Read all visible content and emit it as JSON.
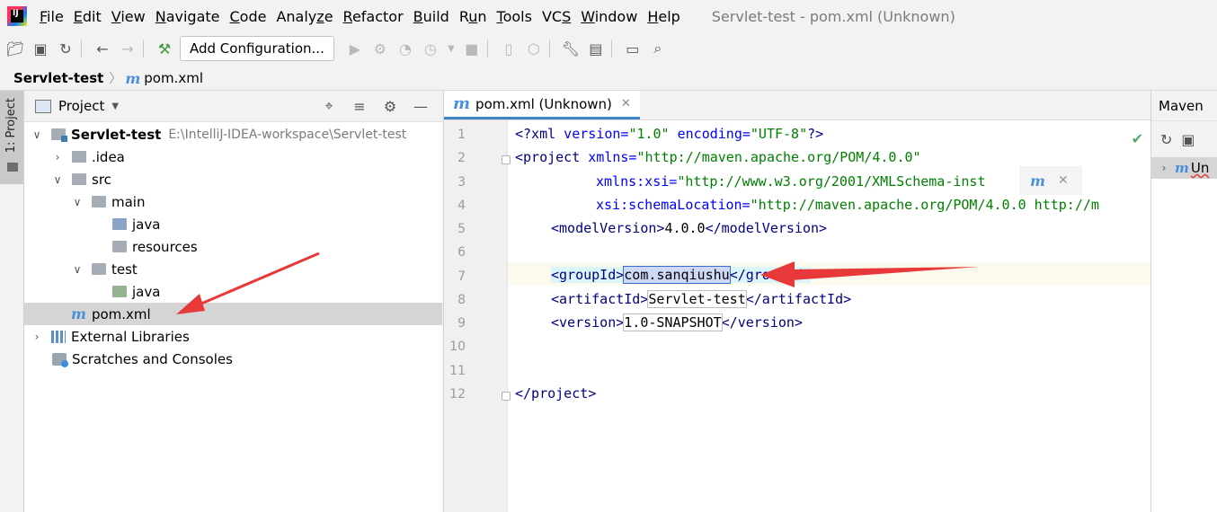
{
  "menubar": {
    "items": [
      {
        "pre": "",
        "ul": "F",
        "post": "ile"
      },
      {
        "pre": "",
        "ul": "E",
        "post": "dit"
      },
      {
        "pre": "",
        "ul": "V",
        "post": "iew"
      },
      {
        "pre": "",
        "ul": "N",
        "post": "avigate"
      },
      {
        "pre": "",
        "ul": "C",
        "post": "ode"
      },
      {
        "pre": "Analy",
        "ul": "z",
        "post": "e"
      },
      {
        "pre": "",
        "ul": "R",
        "post": "efactor"
      },
      {
        "pre": "",
        "ul": "B",
        "post": "uild"
      },
      {
        "pre": "R",
        "ul": "u",
        "post": "n"
      },
      {
        "pre": "",
        "ul": "T",
        "post": "ools"
      },
      {
        "pre": "VC",
        "ul": "S",
        "post": ""
      },
      {
        "pre": "",
        "ul": "W",
        "post": "indow"
      },
      {
        "pre": "",
        "ul": "H",
        "post": "elp"
      }
    ],
    "window_title": "Servlet-test - pom.xml (Unknown)",
    "logo_text": "IJ"
  },
  "toolbar": {
    "add_config_label": "Add Configuration..."
  },
  "breadcrumb": {
    "project": "Servlet-test",
    "file": "pom.xml"
  },
  "stripe": {
    "project_label": "1: Project"
  },
  "project_panel": {
    "header_label": "Project",
    "tree": [
      {
        "label": "Servlet-test",
        "path": "E:\\IntelliJ-IDEA-workspace\\Servlet-test"
      },
      {
        "label": ".idea"
      },
      {
        "label": "src"
      },
      {
        "label": "main"
      },
      {
        "label": "java"
      },
      {
        "label": "resources"
      },
      {
        "label": "test"
      },
      {
        "label": "java"
      },
      {
        "label": "pom.xml"
      },
      {
        "label": "External Libraries"
      },
      {
        "label": "Scratches and Consoles"
      }
    ]
  },
  "editor": {
    "tab_label": "pom.xml (Unknown)",
    "line_numbers": [
      "1",
      "2",
      "3",
      "4",
      "5",
      "6",
      "7",
      "8",
      "9",
      "10",
      "11",
      "12"
    ],
    "code": {
      "l1_tag": "<?xml",
      "l1_a1": " version=",
      "l1_v1": "\"1.0\"",
      "l1_a2": " encoding=",
      "l1_v2": "\"UTF-8\"",
      "l1_end": "?>",
      "l2_tag": "<project",
      "l2_a": " xmlns=",
      "l2_v": "\"http://maven.apache.org/POM/4.0.0\"",
      "l3_a": "xmlns:xsi=",
      "l3_v": "\"http://www.w3.org/2001/XMLSchema-inst",
      "l4_a": "xsi:schemaLocation=",
      "l4_v": "\"http://maven.apache.org/POM/4.0.0 http://m",
      "l5_open": "<modelVersion>",
      "l5_txt": "4.0.0",
      "l5_close": "</modelVersion>",
      "l7_open": "<groupId>",
      "l7_txt": "com.sanqiushu",
      "l7_close": "</groupId>",
      "l8_open": "<artifactId>",
      "l8_txt": "Servlet-test",
      "l8_close": "</artifactId>",
      "l9_open": "<version>",
      "l9_txt": "1.0-SNAPSHOT",
      "l9_close": "</version>",
      "l12": "</project>"
    }
  },
  "maven_panel": {
    "title": "Maven",
    "row_label": "Un"
  },
  "colors": {
    "accent": "#4083c9",
    "arrow": "#e8393a"
  }
}
